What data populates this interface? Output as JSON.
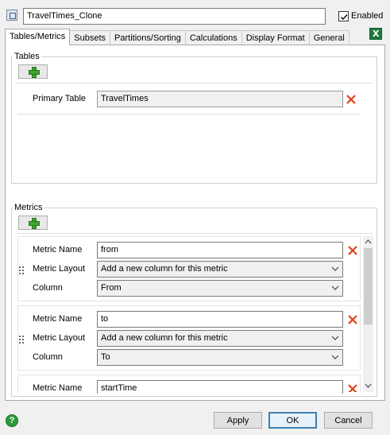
{
  "header": {
    "name_value": "TravelTimes_Clone",
    "enabled_label": "Enabled",
    "enabled_checked": true
  },
  "tabs": [
    {
      "label": "Tables/Metrics",
      "active": true
    },
    {
      "label": "Subsets"
    },
    {
      "label": "Partitions/Sorting"
    },
    {
      "label": "Calculations"
    },
    {
      "label": "Display Format"
    },
    {
      "label": "General"
    }
  ],
  "tables": {
    "group_label": "Tables",
    "primary_table_label": "Primary Table",
    "primary_table_value": "TravelTimes"
  },
  "metrics": {
    "group_label": "Metrics",
    "rows": [
      {
        "name_label": "Metric Name",
        "name_value": "from",
        "layout_label": "Metric Layout",
        "layout_value": "Add a new column for this metric",
        "column_label": "Column",
        "column_value": "From"
      },
      {
        "name_label": "Metric Name",
        "name_value": "to",
        "layout_label": "Metric Layout",
        "layout_value": "Add a new column for this metric",
        "column_label": "Column",
        "column_value": "To"
      },
      {
        "name_label": "Metric Name",
        "name_value": "startTime"
      }
    ]
  },
  "footer": {
    "help_glyph": "?",
    "apply_label": "Apply",
    "ok_label": "OK",
    "cancel_label": "Cancel"
  },
  "colors": {
    "delete_x": "#e2401c",
    "add_green": "#3ea52f",
    "excel_green": "#1d7a3e",
    "ok_border": "#3c7fb1"
  },
  "icons": [
    "window-icon",
    "checkbox-check-icon",
    "excel-export-icon",
    "add-icon",
    "delete-icon",
    "chevron-down-icon",
    "drag-grip-icon",
    "scroll-up-icon",
    "scroll-down-icon",
    "help-icon"
  ]
}
